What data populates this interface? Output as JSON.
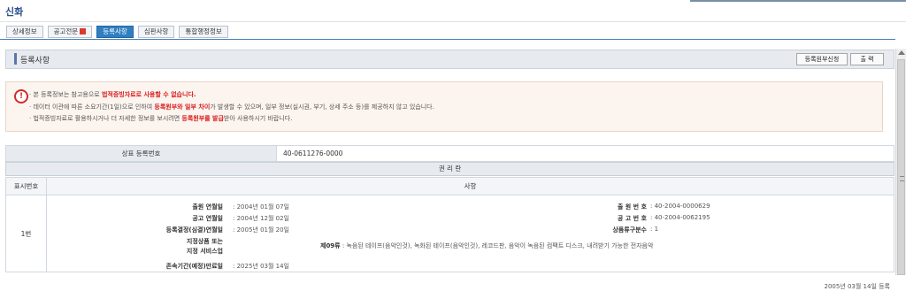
{
  "app": {
    "title": "신화"
  },
  "tabs": [
    {
      "label": "상세정보",
      "active": false
    },
    {
      "label": "공고전문",
      "active": false,
      "icon": "pdf-icon"
    },
    {
      "label": "등록사항",
      "active": true
    },
    {
      "label": "심판사항",
      "active": false
    },
    {
      "label": "통합행정정보",
      "active": false
    }
  ],
  "section": {
    "title": "등록사항",
    "request_button": "등록원부신청",
    "print_button": "출 력"
  },
  "notice": {
    "line1_pre": "본 등록정보는 참고용으로 ",
    "line1_red": "법적증빙자료로 사용할 수 없습니다.",
    "line2_pre": "데이터 이관에 따른 소요기간(1일)으로 인하여 ",
    "line2_red": "등록원부와 일부 차이",
    "line2_post": "가 발생할 수 있으며, 일부 정보(실시권, 부기, 상세 주소 등)를 제공하지 않고 있습니다.",
    "line3_pre": "법적증빙자료로 활용하시거나 더 자세한 정보를 보시려면 ",
    "line3_red": "등록원부를 발급",
    "line3_post": "받아 사용하시기 바랍니다."
  },
  "registration": {
    "label": "상표 등록번호",
    "value": "40-0611276-0000"
  },
  "rights": {
    "header": "권 리 란",
    "col_index": "표시번호",
    "col_content": "사항",
    "row": {
      "index": "1번",
      "left": [
        {
          "label": "출원 연월일",
          "value": ": 2004년 01월 07일"
        },
        {
          "label": "공고 연월일",
          "value": ": 2004년 12월 02일"
        },
        {
          "label": "등록결정(심결)연월일",
          "value": ": 2005년 01월 20일"
        },
        {
          "label": "지정상품 또는",
          "value": ""
        },
        {
          "label": "지정 서비스업",
          "value": ""
        },
        {
          "label": "존속기간(예정)만료일",
          "value": ": 2025년 03월 14일"
        }
      ],
      "right": [
        {
          "label": "출 원 번 호",
          "value": ": 40-2004-0000629"
        },
        {
          "label": "공 고 번 호",
          "value": ": 40-2004-0062195"
        },
        {
          "label": "상품류구분수",
          "value": ": 1"
        }
      ],
      "goods_class": "제09류",
      "goods_text": ": 녹음된 테이프(음악인것), 녹화된 테이프(음악인것), 레코드판, 음악이 녹음된 컴팩트 디스크, 내려받기 가능한 전자음악",
      "registered": "2005년 03월 14일 등록"
    }
  }
}
